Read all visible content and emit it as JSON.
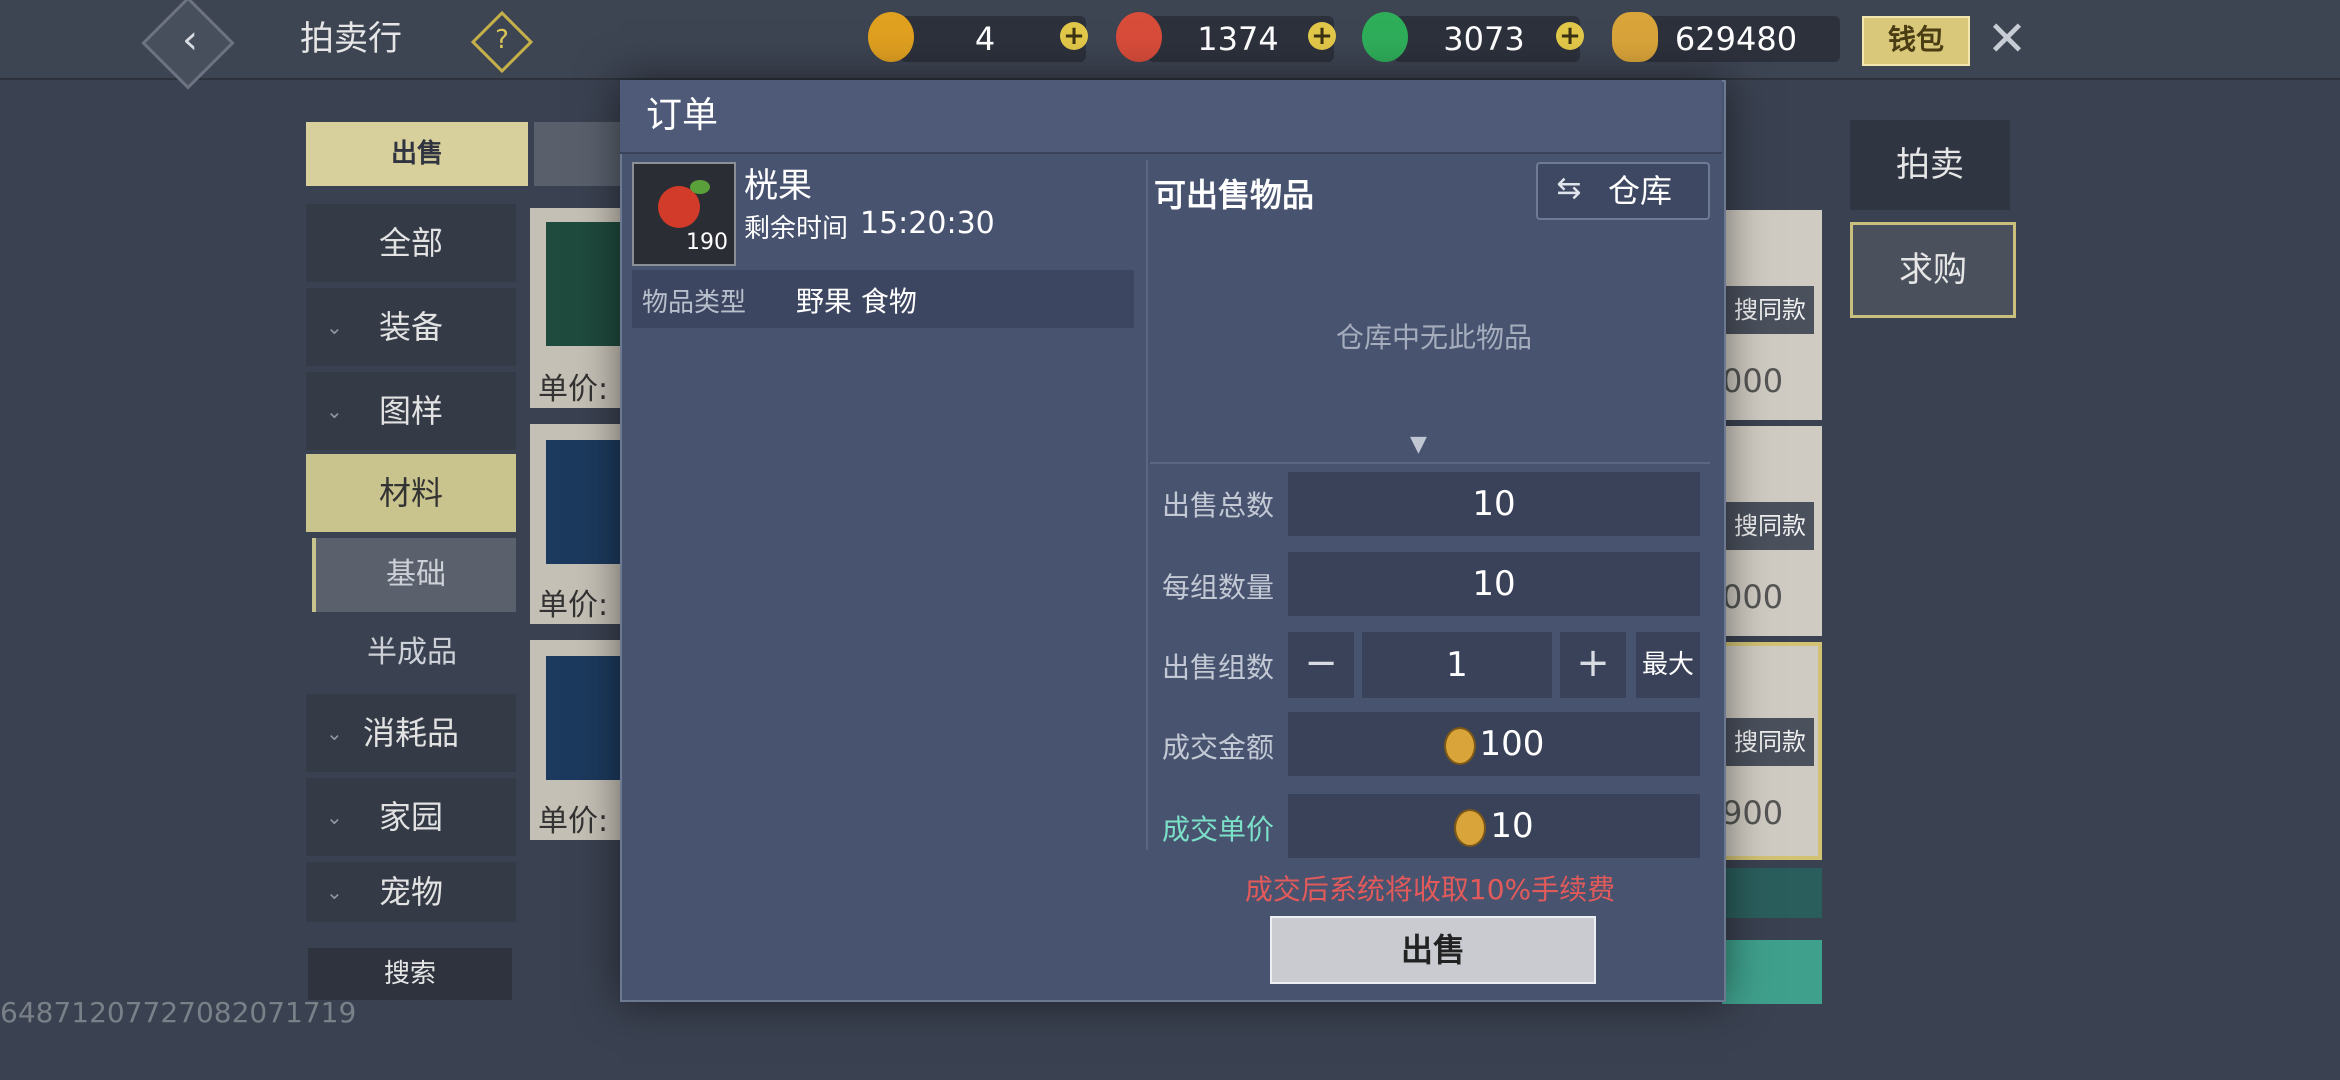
{
  "topbar": {
    "title": "拍卖行",
    "help_label": "?",
    "currencies": [
      {
        "name": "flame-token-icon",
        "value": "4",
        "color": "#e0a020"
      },
      {
        "name": "red-swirl-coin-icon",
        "value": "1374",
        "color": "#d84c3a"
      },
      {
        "name": "jade-coin-icon",
        "value": "3073",
        "color": "#2fae5a"
      },
      {
        "name": "gold-seed-icon",
        "value": "629480",
        "color": "#d9a43a"
      }
    ],
    "plus_label": "+",
    "wallet_label": "钱包",
    "close_label": "✕"
  },
  "background": {
    "tab_sell": "出售",
    "categories": [
      "全部",
      "装备",
      "图样",
      "材料",
      "消耗品",
      "家园",
      "宠物"
    ],
    "subcategories": [
      "基础",
      "半成品"
    ],
    "search_label": "搜索",
    "unit_price_label": "单价:",
    "same_item_label": "搜同款",
    "price_tails": [
      "000",
      "000",
      "900"
    ],
    "right_tabs": [
      "拍卖",
      "求购"
    ],
    "footer_id": "6487120772708207171​9"
  },
  "modal": {
    "title": "订单",
    "item": {
      "name": "桄果",
      "count": "190",
      "remain_label": "剩余时间",
      "remain_value": "15:20:30",
      "type_label": "物品类型",
      "type_value": "野果 食物"
    },
    "sellable_title": "可出售物品",
    "warehouse_label": "仓库",
    "empty_note": "仓库中无此物品",
    "fields": {
      "total_label": "出售总数",
      "total_value": "10",
      "per_group_label": "每组数量",
      "per_group_value": "10",
      "groups_label": "出售组数",
      "groups_value": "1",
      "max_label": "最大",
      "amount_label": "成交金额",
      "amount_value": "100",
      "unit_label": "成交单价",
      "unit_value": "10"
    },
    "fee_note": "成交后系统将收取10%手续费",
    "sell_button": "出售"
  }
}
